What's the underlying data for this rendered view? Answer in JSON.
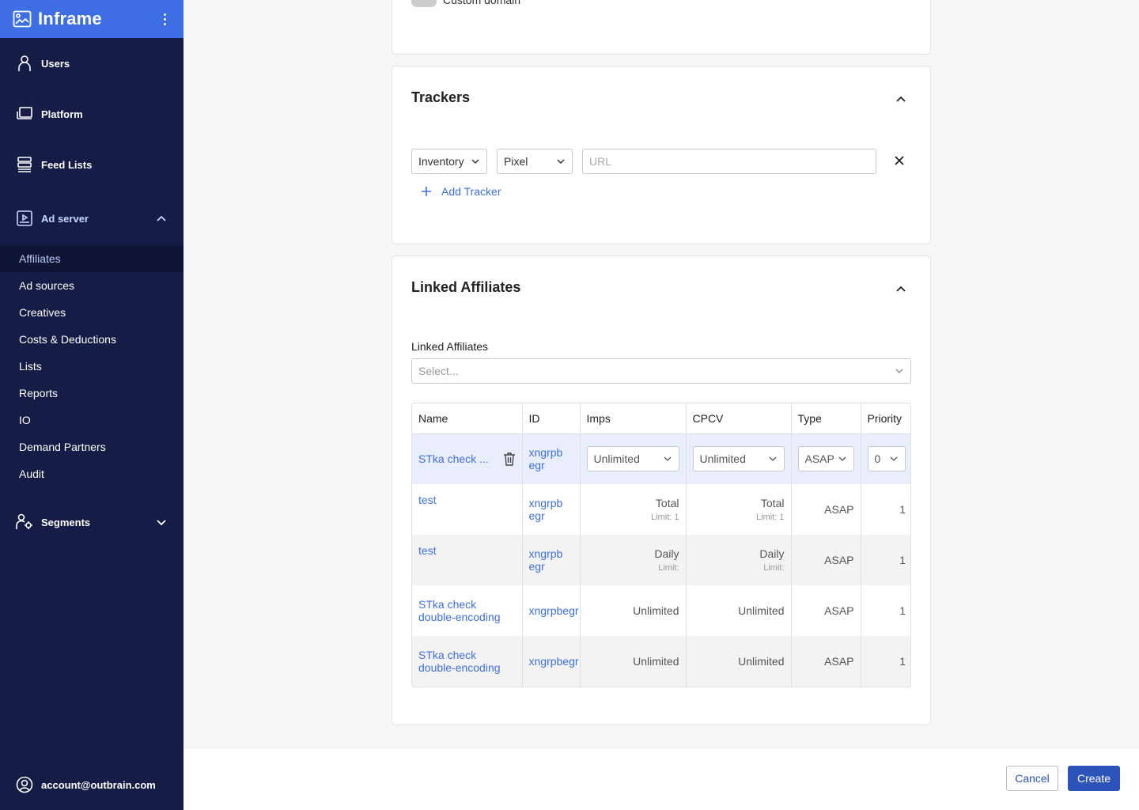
{
  "brand": {
    "name": "Inframe"
  },
  "sidebar": {
    "main_items": [
      {
        "label": "Users",
        "icon": "user-icon"
      },
      {
        "label": "Platform",
        "icon": "platform-icon"
      },
      {
        "label": "Feed Lists",
        "icon": "feed-lists-icon"
      },
      {
        "label": "Ad server",
        "icon": "ad-server-icon"
      }
    ],
    "ad_server_items": [
      "Affiliates",
      "Ad sources",
      "Creatives",
      "Costs & Deductions",
      "Lists",
      "Reports",
      "IO",
      "Demand Partners",
      "Audit"
    ],
    "active_item": "Affiliates",
    "segments_label": "Segments",
    "account": "account@outbrain.com"
  },
  "top_card": {
    "toggle_label": "Custom domain"
  },
  "trackers": {
    "title": "Trackers",
    "type_select": "Inventory",
    "format_select": "Pixel",
    "url_placeholder": "URL",
    "add_label": "Add Tracker"
  },
  "linked": {
    "title": "Linked Affiliates",
    "field_label": "Linked Affiliates",
    "select_placeholder": "Select...",
    "columns": [
      "Name",
      "ID",
      "Imps",
      "CPCV",
      "Type",
      "Priority"
    ],
    "editing_row": {
      "name": "STka check ...",
      "id": "xngrpb egr",
      "imps": "Unlimited",
      "cpcv": "Unlimited",
      "type": "ASAP",
      "priority": "0"
    },
    "rows": [
      {
        "name": "test",
        "id": "xngrpb egr",
        "imps": "Total",
        "imps_sub": "Limit: 1",
        "cpcv": "Total",
        "cpcv_sub": "Limit: 1",
        "type": "ASAP",
        "priority": "1"
      },
      {
        "name": "test",
        "id": "xngrpb egr",
        "imps": "Daily",
        "imps_sub": "Limit:",
        "cpcv": "Daily",
        "cpcv_sub": "Limit:",
        "type": "ASAP",
        "priority": "1"
      },
      {
        "name": "STka check double-encoding",
        "id": "xngrpbegr",
        "imps": "Unlimited",
        "cpcv": "Unlimited",
        "type": "ASAP",
        "priority": "1"
      },
      {
        "name": "STka check double-encoding",
        "id": "xngrpbegr",
        "imps": "Unlimited",
        "cpcv": "Unlimited",
        "type": "ASAP",
        "priority": "1"
      }
    ]
  },
  "footer": {
    "cancel_label": "Cancel",
    "create_label": "Create"
  },
  "colors": {
    "sidebar_bg": "#151c45",
    "brand_bg": "#3d6ee3",
    "accent": "#2b53b9",
    "link": "#3d6ee3"
  }
}
